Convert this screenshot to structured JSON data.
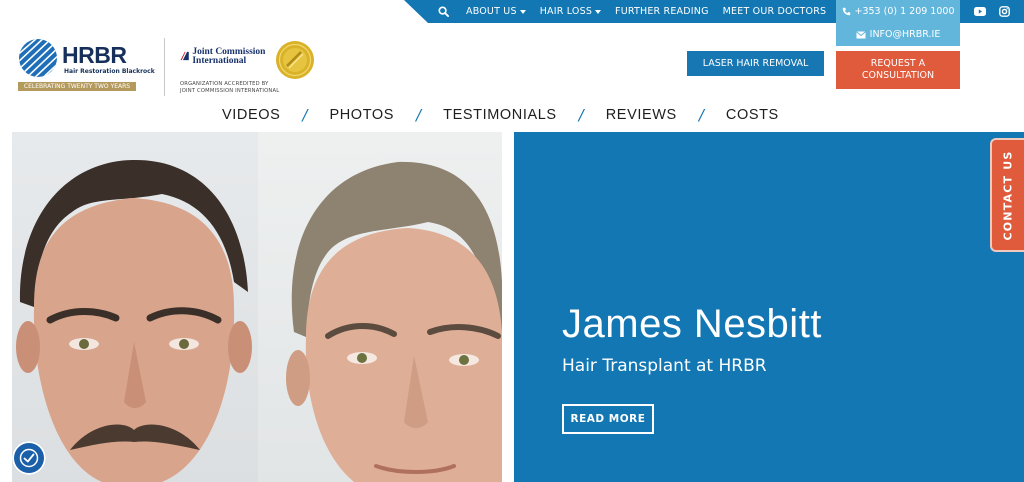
{
  "topnav": {
    "items": [
      {
        "label": "ABOUT US",
        "has_dropdown": true
      },
      {
        "label": "HAIR LOSS",
        "has_dropdown": true
      },
      {
        "label": "FURTHER READING",
        "has_dropdown": false
      },
      {
        "label": "MEET OUR DOCTORS",
        "has_dropdown": false
      }
    ],
    "phone": "+353 (0) 1 209 1000",
    "email": "INFO@HRBR.IE"
  },
  "logo": {
    "brand": "HRBR",
    "subtitle": "Hair Restoration Blackrock",
    "banner": "CELEBRATING TWENTY TWO YEARS"
  },
  "accreditation": {
    "name": "Joint Commission International",
    "line1": "ORGANIZATION ACCREDITED BY",
    "line2": "JOINT COMMISSION INTERNATIONAL"
  },
  "actions": {
    "laser": "LASER HAIR REMOVAL",
    "consult": "REQUEST A CONSULTATION"
  },
  "mainnav": {
    "items": [
      "VIDEOS",
      "PHOTOS",
      "TESTIMONIALS",
      "REVIEWS",
      "COSTS"
    ],
    "separator": "/"
  },
  "hero": {
    "name": "James Nesbitt",
    "subtitle": "Hair Transplant at HRBR",
    "cta": "READ MORE"
  },
  "contact_tab": "CONTACT US",
  "colors": {
    "primary_blue": "#1277b3",
    "light_blue": "#62b6dc",
    "accent_orange": "#e05a3c",
    "brand_navy": "#16305b",
    "gold": "#b59a5e"
  },
  "icons": [
    "search-icon",
    "phone-icon",
    "envelope-icon",
    "youtube-icon",
    "instagram-icon",
    "accessibility-icon",
    "globe-logo-icon",
    "gold-seal-icon"
  ]
}
